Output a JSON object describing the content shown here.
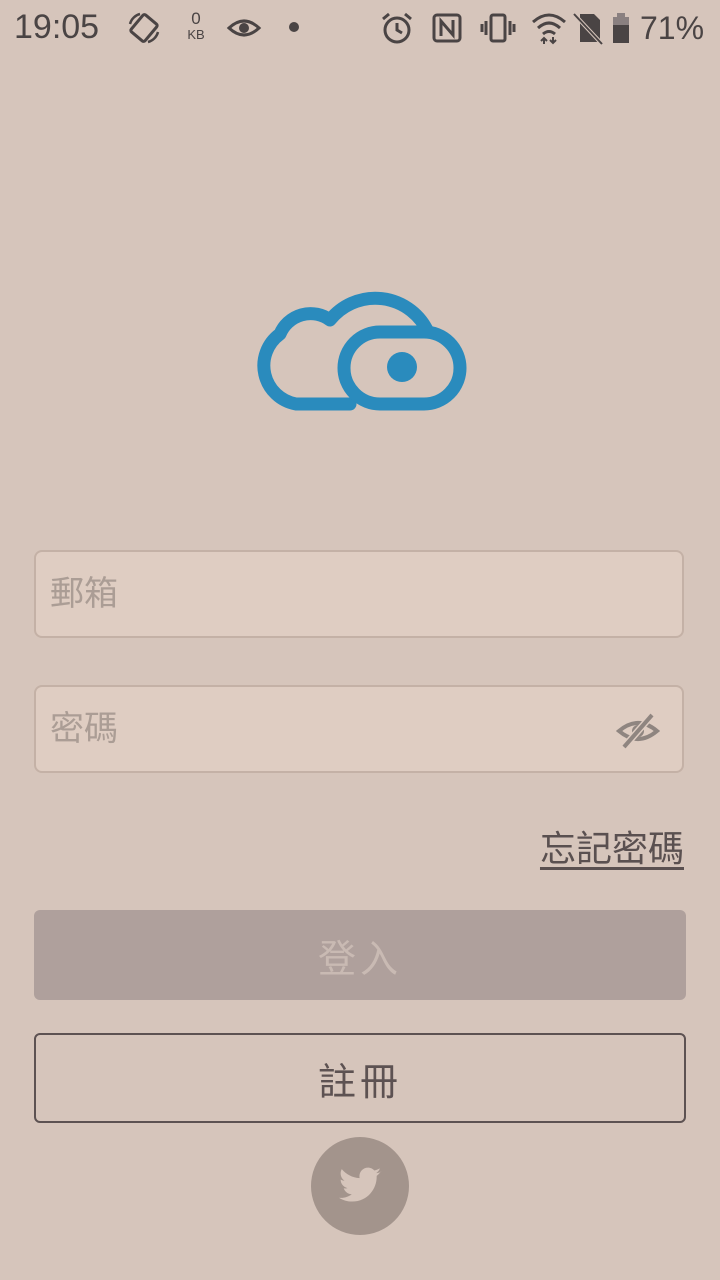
{
  "status_bar": {
    "time": "19:05",
    "data_speed_value": "0",
    "data_speed_unit": "KB",
    "battery_percent": "71%",
    "icons": [
      "rotate-icon",
      "eye-icon",
      "dot-icon",
      "alarm-icon",
      "nfc-icon",
      "vibrate-icon",
      "wifi-icon",
      "no-sim-icon",
      "battery-icon"
    ]
  },
  "logo": {
    "name": "cloud-logo",
    "color": "#2a8bbd"
  },
  "login_form": {
    "email_placeholder": "郵箱",
    "email_value": "",
    "password_placeholder": "密碼",
    "password_value": "",
    "forgot_password_label": "忘記密碼",
    "login_label": "登入",
    "register_label": "註冊",
    "social_icon": "twitter-icon"
  },
  "colors": {
    "background": "#d6c5bb",
    "accent": "#2a8bbd",
    "login_disabled": "#afa09c"
  }
}
